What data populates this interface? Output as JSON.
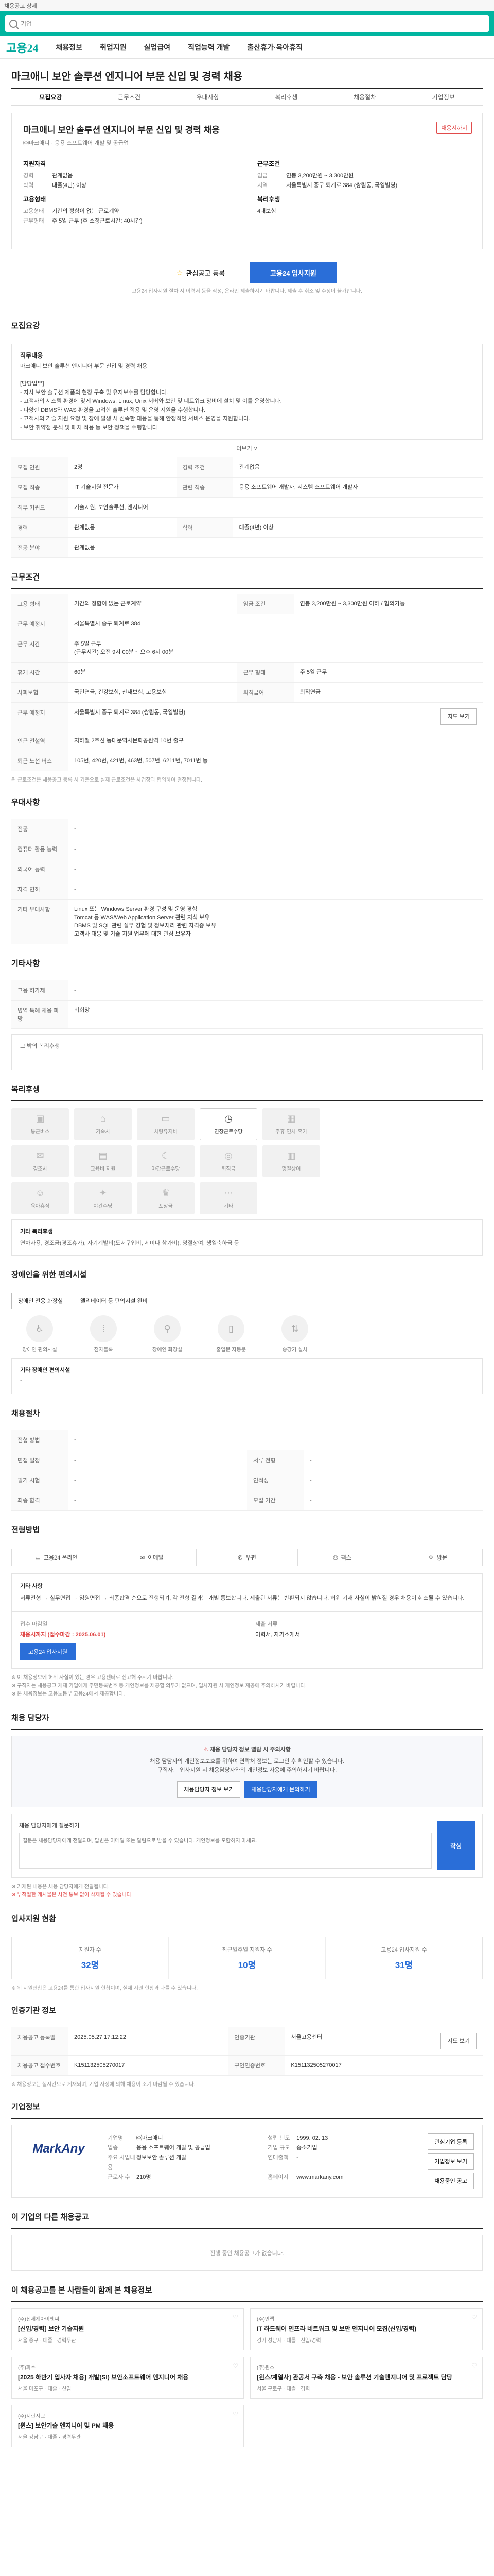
{
  "topbar": {
    "text": "채용공고 상세"
  },
  "search": {
    "placeholder": "기업"
  },
  "nav": {
    "logo": "고용24",
    "items": [
      "채용정보",
      "취업지원",
      "실업급여",
      "직업능력 개발",
      "출산휴가·육아휴직"
    ]
  },
  "job": {
    "title": "마크애니 보안 솔루션 엔지니어 부문 신입 및 경력 채용"
  },
  "subtabs": [
    "모집요강",
    "근무조건",
    "우대사항",
    "복리후생",
    "채용절차",
    "기업정보"
  ],
  "summary": {
    "title": "마크애니 보안 솔루션 엔지니어 부문 신입 및 경력 채용",
    "tags": "㈜마크애니 · 응용 소프트웨어 개발 및 공급업",
    "badge": "채용시까지",
    "left_heading": "지원자격",
    "left": [
      {
        "k": "경력",
        "v": "관계없음"
      },
      {
        "k": "학력",
        "v": "대졸(4년) 이상"
      }
    ],
    "left2_heading": "고용형태",
    "left2": [
      {
        "k": "고용형태",
        "v": "기간의 정함이 없는 근로계약"
      },
      {
        "k": "근무형태",
        "v": "주 5일 근무 (주 소정근로시간: 40시간)"
      }
    ],
    "right_heading": "근무조건",
    "right": [
      {
        "k": "임금",
        "v": "연봉 3,200만원 ~ 3,300만원"
      },
      {
        "k": "지역",
        "v": "서울특별시 중구 퇴계로 384 (쌍림동, 국일빌딩)"
      }
    ],
    "right2_heading": "복리후생",
    "right2": [
      {
        "k": "",
        "v": "4대보험"
      }
    ]
  },
  "apply": {
    "scrap_label": "관심공고 등록",
    "apply_label": "고용24 입사지원",
    "note": "고용24 입사지원 절차 시 이력서 등을 작성, 온라인 제출하시기 바랍니다. 제출 후 취소 및 수정이 불가합니다."
  },
  "requirements": {
    "section_title": "모집요강",
    "box_heading": "직무내용",
    "body": "마크애니 보안 솔루션 엔지니어 부문 신입 및 경력 채용\n\n[담당업무]\n- 자사 보안 솔루션 제품의 현장 구축 및 유지보수를 담당합니다.\n- 고객사의 시스템 환경에 맞게 Windows, Linux, Unix 서버와 보안 및 네트워크 장비에 설치 및 이를 운영합니다.\n- 다양한 DBMS와 WAS 환경을 고려한 솔루션 적용 및 운영 지원을 수행합니다.\n- 고객사의 기술 지원 요청 및 장애 발생 시 신속한 대응을 통해 안정적인 서비스 운영을 지원합니다.\n- 보안 취약점 분석 및 패치 적용 등 보안 정책을 수행합니다.",
    "more_label": "더보기 ∨",
    "rows": [
      {
        "k": "모집 인원",
        "v": "2명",
        "k2": "경력 조건",
        "v2": "관계없음"
      },
      {
        "k": "모집 직종",
        "v": "IT 기술지원 전문가",
        "k2": "관련 직종",
        "v2": "응용 소프트웨어 개발자, 시스템 소프트웨어 개발자"
      },
      {
        "k": "직무 키워드",
        "v": "기술지원, 보안솔루션, 엔지니어",
        "k2": "",
        "v2": ""
      },
      {
        "k": "경력",
        "v": "관계없음",
        "k2": "학력",
        "v2": "대졸(4년) 이상"
      },
      {
        "k": "전공 분야",
        "v": "관계없음",
        "k2": "",
        "v2": ""
      }
    ]
  },
  "conditions": {
    "section_title": "근무조건",
    "rows": [
      {
        "k": "고용 형태",
        "v": "기간의 정함이 없는 근로계약",
        "k2": "임금 조건",
        "v2": "연봉 3,200만원 ~ 3,300만원 이하 / 협의가능"
      },
      {
        "k": "근무 예정지",
        "v": "서울특별시 중구 퇴계로 384",
        "k2": "",
        "v2": ""
      },
      {
        "k": "근무 시간",
        "v": "주 5일 근무\n(근무시간) 오전 9시 00분 ~ 오후 6시 00분",
        "k2": "",
        "v2": ""
      },
      {
        "k": "휴게 시간",
        "v": "60분",
        "k2": "근무 형태",
        "v2": "주 5일 근무"
      },
      {
        "k": "사회보험",
        "v": "국민연금, 건강보험, 산재보험, 고용보험",
        "k2": "퇴직급여",
        "v2": "퇴직연금"
      },
      {
        "k": "근무 예정지",
        "v": "서울특별시 중구 퇴계로 384 (쌍림동, 국일빌딩)",
        "k2": "",
        "v2": ""
      },
      {
        "k": "인근 전철역",
        "v": "지하철 2호선 동대문역사문화공원역 10번 출구",
        "k2": "",
        "v2": ""
      },
      {
        "k": "퇴근 노선 버스",
        "v": "105번, 420번, 421번, 463번, 507번, 6211번, 7011번 등",
        "k2": "",
        "v2": ""
      }
    ],
    "map_label": "지도 보기",
    "note": "위 근로조건은 채용공고 등록 시 기준으로 실제 근로조건은 사업장과 협의하여 결정됩니다."
  },
  "preferences": {
    "section_title": "우대사항",
    "rows": [
      {
        "k": "전공",
        "v": "-"
      },
      {
        "k": "컴퓨터 활용 능력",
        "v": "-"
      },
      {
        "k": "외국어 능력",
        "v": "-"
      },
      {
        "k": "자격 면허",
        "v": "-"
      },
      {
        "k": "기타 우대사항",
        "v": "Linux 또는 Windows Server 환경 구성 및 운영 경험\nTomcat 등 WAS/Web Application Server 관련 지식 보유\nDBMS 및 SQL 관련 실무 경험 및 정보처리 관련 자격증 보유\n고객사 대응 및 기술 지원 업무에 대한 관심 보유자"
      }
    ]
  },
  "other": {
    "section_title": "기타사항",
    "rows": [
      {
        "k": "고용 허가제",
        "v": "-"
      },
      {
        "k": "병역 특례 채용 희망",
        "v": "비희망"
      }
    ],
    "box": "그 밖의 복리후생"
  },
  "benefits": {
    "section_title": "복리후생",
    "items": [
      {
        "label": "통근버스",
        "active": false
      },
      {
        "label": "기숙사",
        "active": false
      },
      {
        "label": "차량유지비",
        "active": false
      },
      {
        "label": "연장근로수당",
        "active": true
      },
      {
        "label": "주휴·연차·휴가",
        "active": false
      },
      {
        "label": "경조사",
        "active": false
      },
      {
        "label": "교육비 지원",
        "active": false
      },
      {
        "label": "야간근로수당",
        "active": false
      },
      {
        "label": "퇴직금",
        "active": false
      },
      {
        "label": "명절상여",
        "active": false
      },
      {
        "label": "육아휴직",
        "active": false
      },
      {
        "label": "야간수당",
        "active": false
      },
      {
        "label": "포상금",
        "active": false
      },
      {
        "label": "기타",
        "active": false
      }
    ],
    "etc_heading": "기타 복리후생",
    "etc_body": "연차사용, 경조금(경조휴가), 자기계발비(도서구입비, 세미나 참가비), 명절상여, 생일축하금 등"
  },
  "facility": {
    "section_title": "장애인을 위한 편의시설",
    "chips": [
      "장애인 전용 화장실",
      "엘리베이터 등 편의시설 완비"
    ],
    "items": [
      "장애인 편의시설",
      "점자블록",
      "장애인 화장실",
      "출입문 자동문",
      "승강기 설치"
    ],
    "etc_heading": "기타 장애인 편의시설",
    "etc_body": "-"
  },
  "procedure": {
    "section_title": "채용절차",
    "rows": [
      {
        "k": "전형 방법",
        "v": "-",
        "k2": "",
        "v2": ""
      },
      {
        "k": "면접 일정",
        "v": "-",
        "k2": "서류 전형",
        "v2": "-"
      },
      {
        "k": "필기 시험",
        "v": "-",
        "k2": "인적성",
        "v2": "-"
      },
      {
        "k": "최종 합격",
        "v": "-",
        "k2": "모집 기간",
        "v2": "-"
      }
    ]
  },
  "apply_method": {
    "section_title": "전형방법",
    "methods": [
      "고용24 온라인",
      "이메일",
      "우편",
      "팩스",
      "방문"
    ],
    "box_heading": "기타 사항",
    "box_body": "서류전형 → 실무면접 → 임원면접 → 최종합격 순으로 진행되며, 각 전형 결과는 개별 통보합니다. 제출된 서류는 반환되지 않습니다. 허위 기재 사실이 밝혀질 경우 채용이 취소될 수 있습니다.",
    "deadline_label": "접수 마감일",
    "deadline_value": "채용시까지 (접수마감 : 2025.06.01)",
    "apply_btn": "고용24 입사지원",
    "docs_label": "제출 서류",
    "docs_value": "이력서, 자기소개서",
    "warns": [
      "※ 이 채용정보에 허위 사실이 있는 경우 고용센터로 신고해 주시기 바랍니다.",
      "※ 구직자는 채용공고 게재 기업에게 주민등록번호 등 개인정보를 제공할 의무가 없으며, 입사지원 시 개인정보 제공에 주의하시기 바랍니다.",
      "※ 본 채용정보는 고용노동부 고용24에서 제공합니다."
    ]
  },
  "manager": {
    "section_title": "채용 담당자",
    "notice_title": "채용 담당자 정보 열람 시 주의사항",
    "notice_body": "채용 담당자의 개인정보보호를 위하여 연락처 정보는 로그인 후 확인할 수 있습니다.\n구직자는 입사지원 시 채용담당자와의 개인정보 사용에 주의하시기 바랍니다.",
    "btn1": "채용담당자 정보 보기",
    "btn2": "채용담당자에게 문의하기"
  },
  "qa": {
    "label": "채용 담당자에게 질문하기",
    "placeholder": "질문은 채용담당자에게 전달되며, 답변은 이메일 또는 알림으로 받을 수 있습니다. 개인정보를 포함하지 마세요.",
    "submit": "작성",
    "notes": [
      "※ 기재된 내용은 채용 담당자에게 전달됩니다.",
      "※ 부적절한 게시물은 사전 통보 없이 삭제될 수 있습니다."
    ]
  },
  "stats": {
    "section_title": "입사지원 현황",
    "items": [
      {
        "label": "지원자 수",
        "value": "32명"
      },
      {
        "label": "최근일주일 지원자 수",
        "value": "10명"
      },
      {
        "label": "고용24 입사지원 수",
        "value": "31명"
      }
    ],
    "note": "※ 위 지원현황은 고용24를 통한 입사지원 현황이며, 실제 지원 현황과 다를 수 있습니다."
  },
  "registration": {
    "section_title": "인증기관 정보",
    "rows": [
      {
        "k": "채용공고 등록일",
        "v": "2025.05.27 17:12:22",
        "k2": "인증기관",
        "v2": "서울고용센터"
      },
      {
        "k": "채용공고 접수번호",
        "v": "K151132505270017",
        "k2": "구인인증번호",
        "v2": "K151132505270017"
      }
    ],
    "map_btn": "지도 보기",
    "note": "※ 채용정보는 실시간으로 게재되며, 기업 사정에 의해 채용이 조기 마감될 수 있습니다."
  },
  "company": {
    "section_title": "기업정보",
    "logo_text": "MarkAny",
    "rows": [
      {
        "k": "기업명",
        "v": "㈜마크애니"
      },
      {
        "k": "업종",
        "v": "응용 소프트웨어 개발 및 공급업"
      },
      {
        "k": "주요 사업내용",
        "v": "정보보안 솔루션 개발"
      },
      {
        "k": "근로자 수",
        "v": "210명"
      },
      {
        "k": "설립 년도",
        "v": "1999. 02. 13"
      },
      {
        "k": "기업 규모",
        "v": "중소기업"
      },
      {
        "k": "연매출액",
        "v": "-"
      },
      {
        "k": "홈페이지",
        "v": "www.markany.com"
      }
    ],
    "btn1": "관심기업 등록",
    "btn2": "기업정보 보기",
    "btn3": "채용중인 공고"
  },
  "other_jobs": {
    "section_title": "이 기업의 다른 채용공고",
    "empty": "진행 중인 채용공고가 없습니다."
  },
  "recommend": {
    "section_title": "이 채용공고를 본 사람들이 함께 본 채용정보",
    "items": [
      {
        "company": "(주)신세계아이앤씨",
        "title": "[신입/경력] 보안 기술지원",
        "meta": "서울 중구 · 대졸 · 경력무관"
      },
      {
        "company": "(주)안랩",
        "title": "IT 하드웨어 인프라 네트워크 및 보안 엔지니어 모집(신입/경력)",
        "meta": "경기 성남시 · 대졸 · 신입/경력"
      },
      {
        "company": "(주)파수",
        "title": "[2025 하반기 입사자 채용] 개발(SI) 보안소프트웨어 엔지니어 채용",
        "meta": "서울 마포구 · 대졸 · 신입"
      },
      {
        "company": "(주)윈스",
        "title": "[윈스/계열사] 관공서 구축 채용 - 보안 솔루션 기술엔지니어 및 프로젝트 담당",
        "meta": "서울 구로구 · 대졸 · 경력"
      },
      {
        "company": "(주)지란지교",
        "title": "[윈스] 보안기술 엔지니어 및 PM 채용",
        "meta": "서울 강남구 · 대졸 · 경력무관"
      },
      {
        "company": "",
        "title": "",
        "meta": ""
      }
    ]
  }
}
